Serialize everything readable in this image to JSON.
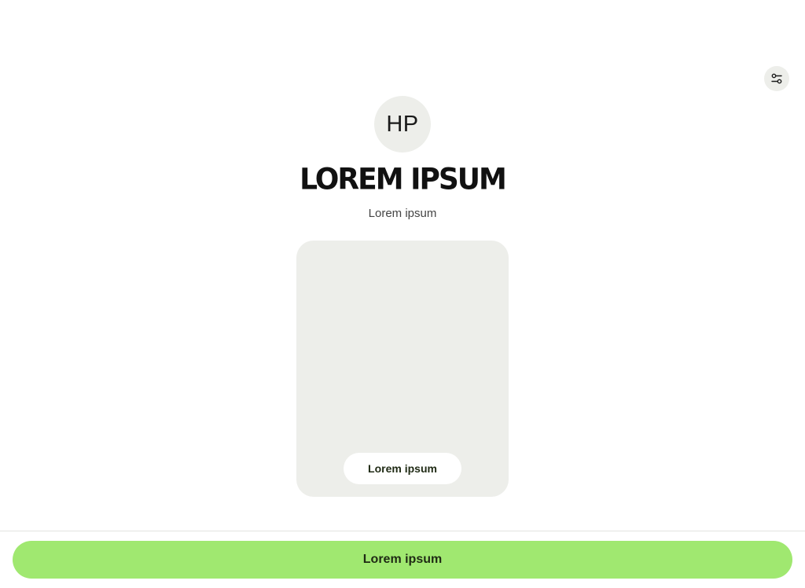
{
  "header": {
    "filter_icon": "settings-sliders-icon"
  },
  "profile": {
    "initials": "HP",
    "title": "LOREM IPSUM",
    "subtitle": "Lorem ipsum"
  },
  "card": {
    "button_label": "Lorem ipsum"
  },
  "footer": {
    "cta_label": "Lorem ipsum"
  },
  "colors": {
    "accent": "#a0e870",
    "surface": "#edeeea",
    "text_dark": "#1f2a14"
  }
}
